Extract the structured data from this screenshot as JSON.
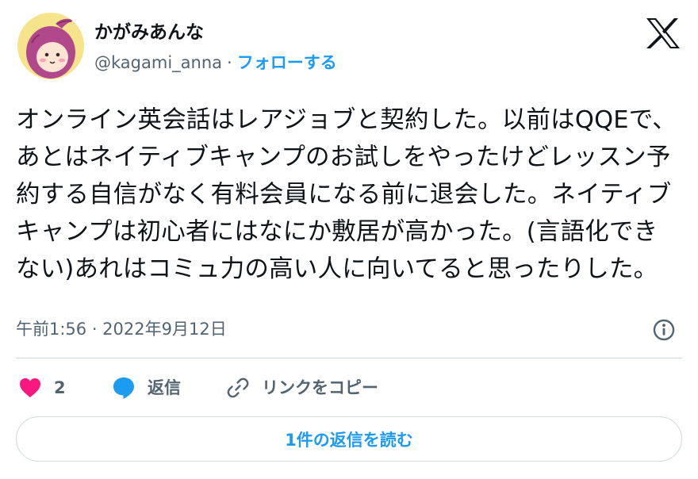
{
  "user": {
    "display_name": "かがみあんな",
    "handle": "@kagami_anna",
    "separator": "·",
    "follow_label": "フォローする",
    "avatar_icon": "sweet-potato-character-avatar"
  },
  "brand": {
    "logo_icon": "x-logo"
  },
  "tweet": {
    "text": "オンライン英会話はレアジョブと契約した。以前はQQEで、あとはネイティブキャンプのお試しをやったけどレッスン予約する自信がなく有料会員になる前に退会した。ネイティブキャンプは初心者にはなにか敷居が高かった。(言語化できない)あれはコミュ力の高い人に向いてると思ったりした。",
    "timestamp": "午前1:56 · 2022年9月12日"
  },
  "actions": {
    "like_count": "2",
    "reply_label": "返信",
    "copy_link_label": "リンクをコピー"
  },
  "replies": {
    "read_label": "1件の返信を読む"
  },
  "colors": {
    "accent": "#1d9bf0",
    "like": "#f91880",
    "secondary_text": "#536471",
    "border": "#cfd9de"
  }
}
